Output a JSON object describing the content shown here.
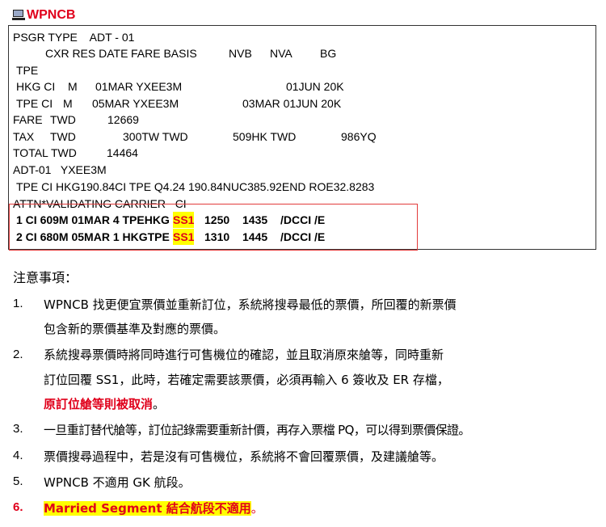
{
  "title": "WPNCB",
  "terminal": {
    "lines": [
      [
        "PSGR TYPE    ADT - 01"
      ],
      [
        "CXR RES DATE",
        "FARE BASIS",
        "NVB",
        "NVA",
        "BG"
      ],
      [
        "TPE"
      ],
      [
        "HKG CI",
        "M",
        "01MAR YXEE3M",
        "01JUN 20K"
      ],
      [
        "TPE CI",
        "M",
        "05MAR YXEE3M",
        "03MAR 01JUN 20K"
      ],
      [
        "FARE",
        "TWD",
        "12669"
      ],
      [
        "TAX",
        "TWD",
        "300TW TWD",
        "509HK TWD",
        "986YQ"
      ],
      [
        "TOTAL TWD",
        "14464"
      ],
      [
        "ADT-01   YXEE3M"
      ],
      [
        "TPE CI HKG190.84CI TPE Q4.24 190.84NUC385.92END ROE32.8283"
      ],
      [
        "ATTN*VALIDATING CARRIER   CI"
      ]
    ],
    "seg1": {
      "pre": "1 CI 609M 01MAR 4 TPEHKG ",
      "status": "SS1",
      "dep": "1250",
      "arr": "1435",
      "tail": "/DCCI /E"
    },
    "seg2": {
      "pre": "2 CI 680M 05MAR 1 HKGTPE ",
      "status": "SS1",
      "dep": "1310",
      "arr": "1445",
      "tail": "/DCCI /E"
    }
  },
  "notes": {
    "heading": "注意事項：",
    "items": [
      {
        "num": "1.",
        "lines": [
          "WPNCB 找更便宜票價並重新訂位，系統將搜尋最低的票價，所回覆的新票價",
          "包含新的票價基準及對應的票價。"
        ]
      },
      {
        "num": "2.",
        "lines": [
          "系統搜尋票價時將同時進行可售機位的確認，並且取消原來艙等，同時重新",
          "訂位回覆 SS1，此時，若確定需要該票價，必須再輸入 6 簽收及 ER 存檔，"
        ],
        "red_line": "原訂位艙等則被取消",
        "red_tail": "。"
      },
      {
        "num": "3.",
        "lines": [
          "一旦重訂替代艙等，訂位記錄需要重新計價，再存入票檔 PQ，可以得到票價保證。"
        ]
      },
      {
        "num": "4.",
        "lines": [
          "票價搜尋過程中，若是沒有可售機位，系統將不會回覆票價，及建議艙等。"
        ]
      },
      {
        "num": "5.",
        "lines": [
          "WPNCB 不適用 GK 航段。"
        ]
      },
      {
        "num": "6.",
        "highlight": "Married Segment 結合航段不適用",
        "tail": "。"
      }
    ]
  }
}
